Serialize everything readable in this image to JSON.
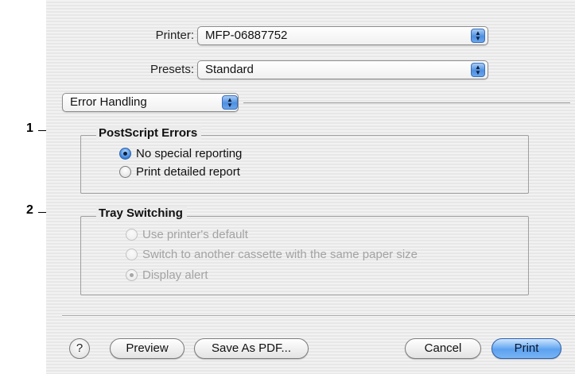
{
  "printer": {
    "label": "Printer:",
    "value": "MFP-06887752"
  },
  "presets": {
    "label": "Presets:",
    "value": "Standard"
  },
  "panel": {
    "value": "Error Handling"
  },
  "callouts": {
    "one": "1",
    "two": "2"
  },
  "postscript_errors": {
    "legend": "PostScript Errors",
    "options": [
      {
        "label": "No special reporting",
        "selected": true,
        "enabled": true
      },
      {
        "label": "Print detailed report",
        "selected": false,
        "enabled": true
      }
    ]
  },
  "tray_switching": {
    "legend": "Tray Switching",
    "options": [
      {
        "label": "Use printer's default",
        "selected": false,
        "enabled": false
      },
      {
        "label": "Switch to another cassette with the same paper size",
        "selected": false,
        "enabled": false
      },
      {
        "label": "Display alert",
        "selected": true,
        "enabled": false
      }
    ]
  },
  "buttons": {
    "help": "?",
    "preview": "Preview",
    "save_pdf": "Save As PDF...",
    "cancel": "Cancel",
    "print": "Print"
  },
  "colors": {
    "accent": "#4f8fe0",
    "dialog_bg": "#ececec",
    "disabled_text": "#a3a3a3"
  }
}
